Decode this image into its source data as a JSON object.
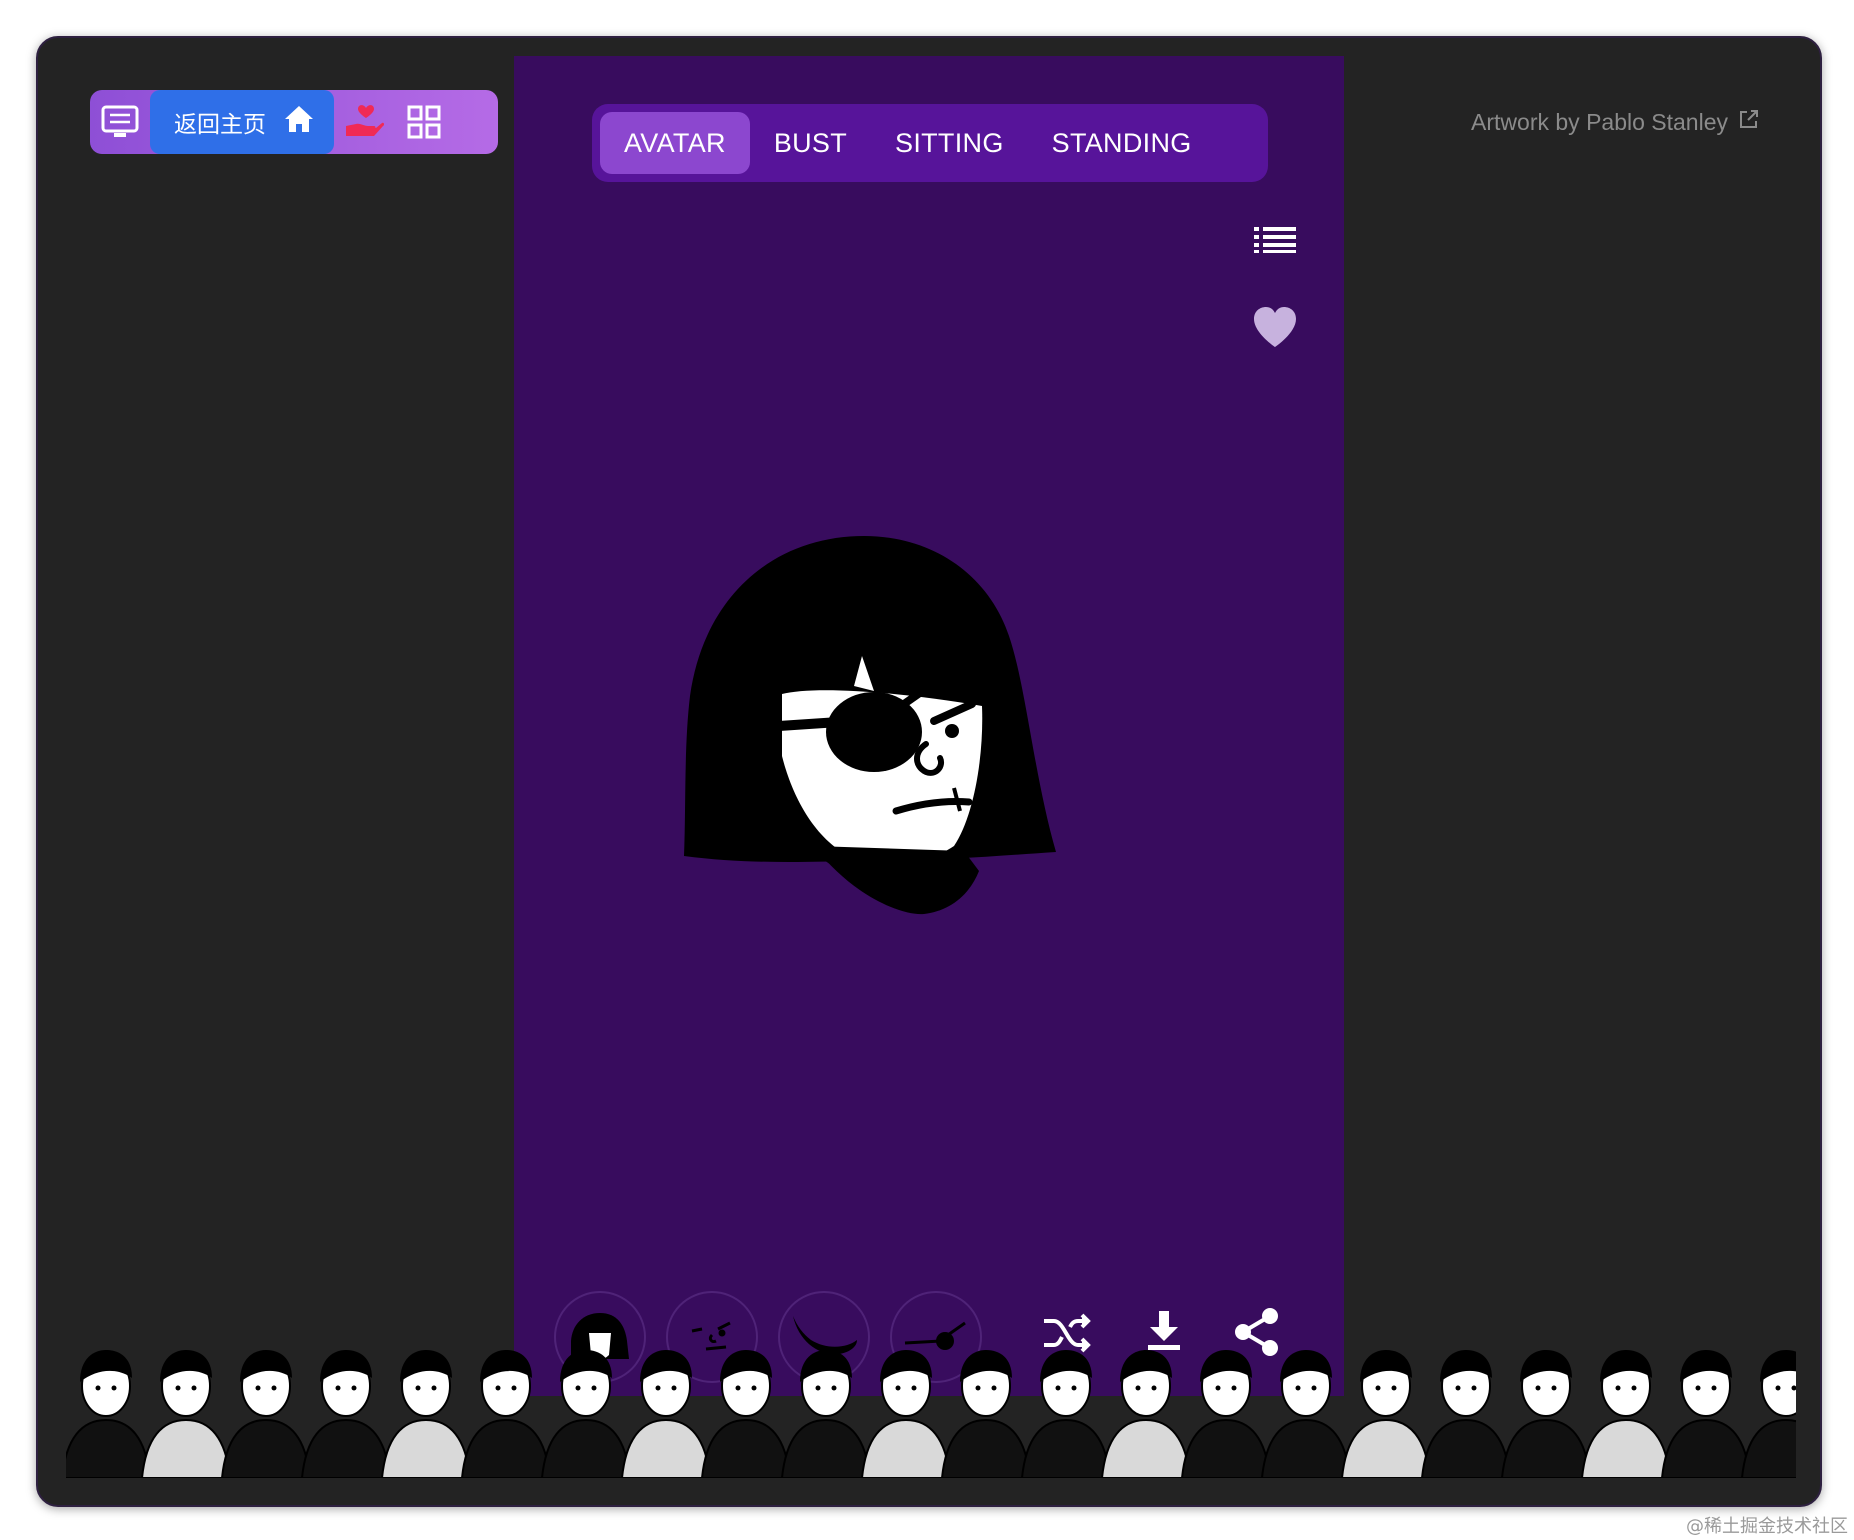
{
  "toolbar": {
    "home_label": "返回主页"
  },
  "tabs": [
    {
      "label": "AVATAR",
      "active": true
    },
    {
      "label": "BUST",
      "active": false
    },
    {
      "label": "SITTING",
      "active": false
    },
    {
      "label": "STANDING",
      "active": false
    }
  ],
  "credit": {
    "text": "Artwork by Pablo Stanley"
  },
  "colors": {
    "panel_bg": "#380c5e",
    "tab_bar": "#57149a",
    "tab_active": "#8c47cf",
    "page_bg": "#232323",
    "home_button": "#2f6fe8"
  },
  "icons": [
    "layout-switch-icon",
    "home-icon",
    "donate-icon",
    "grid-icon",
    "list-icon",
    "heart-icon",
    "shuffle-icon",
    "download-icon",
    "share-icon",
    "external-link-icon"
  ],
  "thumbnails": [
    "hair-option",
    "face-option",
    "facial-hair-option",
    "accessory-option"
  ],
  "watermark": "@稀土掘金技术社区"
}
